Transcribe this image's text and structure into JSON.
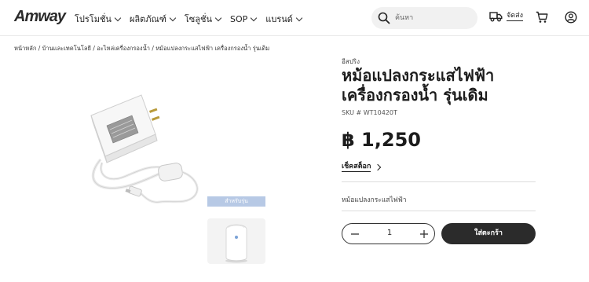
{
  "header": {
    "logo": "Amway",
    "nav": [
      "โปรโมชั่น",
      "ผลิตภัณฑ์",
      "โซลูชั่น",
      "SOP",
      "แบรนด์"
    ],
    "search_placeholder": "ค้นหา",
    "delivery_label": "จัดส่ง"
  },
  "breadcrumb": {
    "items": [
      "หน้าหลัก",
      "บ้านและเทคโนโลยี",
      "อะไหล่เครื่องกรองน้ำ",
      "หม้อแปลงกระแสไฟฟ้า เครื่องกรองน้ำ รุ่นเดิม"
    ],
    "separator": " / "
  },
  "thumbnail": {
    "label": "สำหรับรุ่น"
  },
  "product": {
    "brand": "อีสปริง",
    "title_line1": "หม้อแปลงกระแสไฟฟ้า",
    "title_line2": "เครื่องกรองน้ำ รุ่นเดิม",
    "sku": "SKU # WT10420T",
    "price": "฿ 1,250",
    "stock_label": "เช็คสต็อก",
    "description": "หม้อแปลงกระแสไฟฟ้า",
    "quantity": "1",
    "add_to_cart": "ใส่ตะกร้า"
  }
}
